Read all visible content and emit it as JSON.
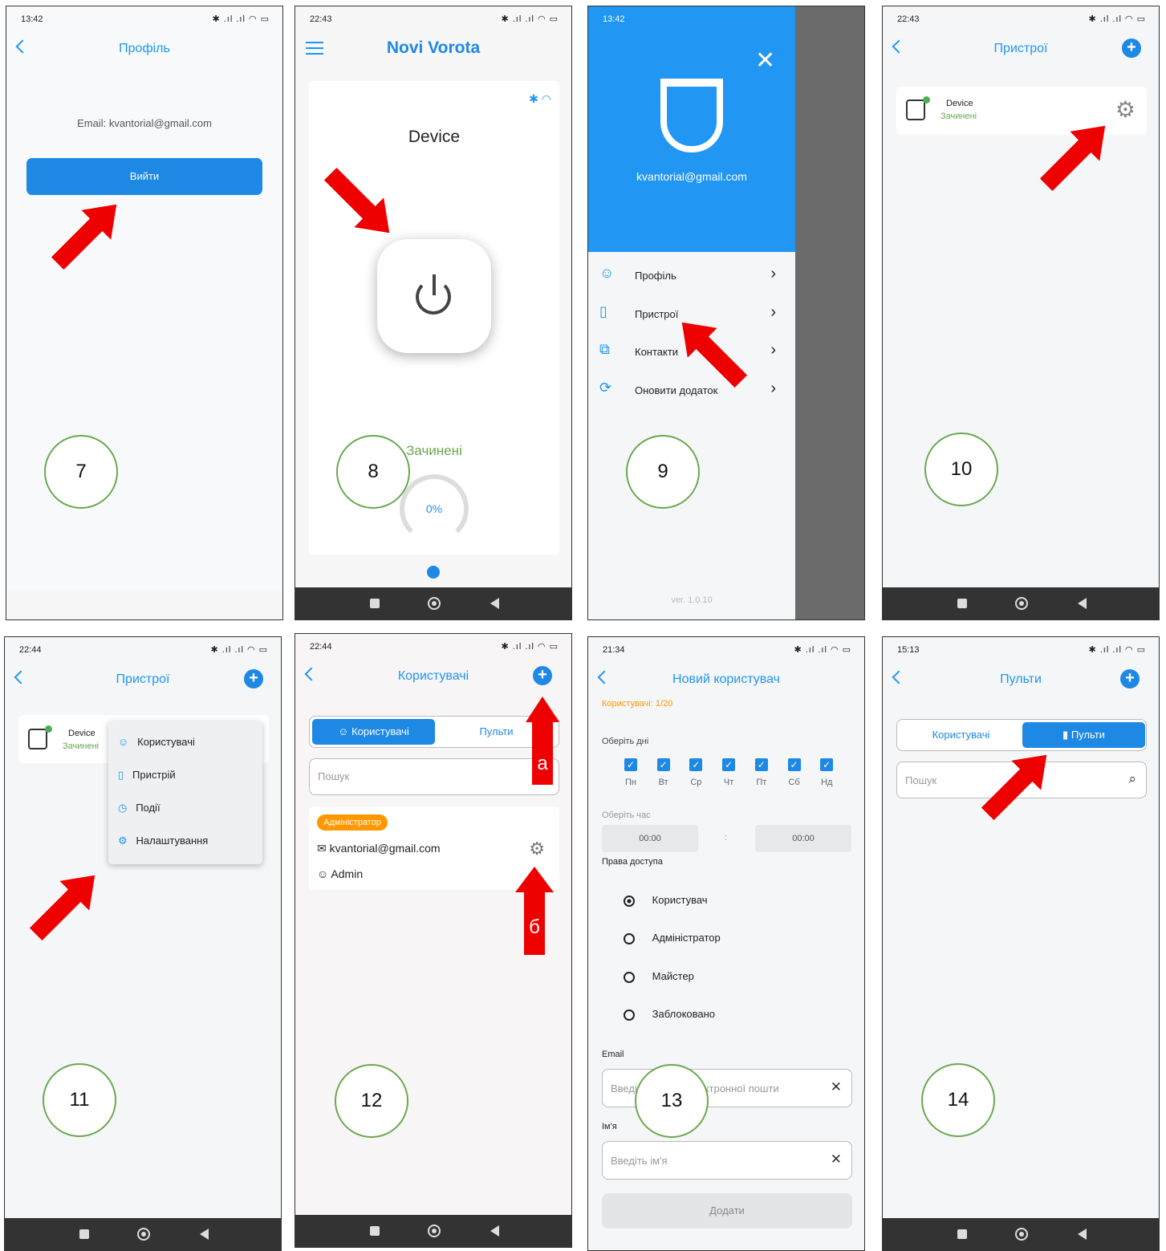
{
  "p7": {
    "time": "13:42",
    "status_icons": "✱ .ıl .ıl ◠ ▭",
    "title": "Профіль",
    "email_label": "Email:",
    "email": "kvantorial@gmail.com",
    "logout": "Вийти",
    "num": "7"
  },
  "p8": {
    "time": "22:43",
    "status_icons": "✱ .ıl .ıl ◠ ▭",
    "title": "Novi Vorota",
    "device": "Device",
    "state": "Зачинені",
    "percent": "0%",
    "num": "8"
  },
  "p9": {
    "time": "13:42",
    "status_icons": "✱ .ıl .ıl ◠ ▭",
    "email": "kvantorial@gmail.com",
    "menu": [
      "Профіль",
      "Пристрої",
      "Контакти",
      "Оновити додаток"
    ],
    "version": "ver. 1.0.10",
    "num": "9"
  },
  "p10": {
    "time": "22:43",
    "status_icons": "✱ .ıl .ıl ◠ ▭",
    "title": "Пристрої",
    "device": "Device",
    "state": "Зачинені",
    "num": "10"
  },
  "p11": {
    "time": "22:44",
    "status_icons": "✱ .ıl .ıl ◠ ▭",
    "title": "Пристрої",
    "device": "Device",
    "state": "Зачинені",
    "menu": [
      "Користувачі",
      "Пристрій",
      "Події",
      "Налаштування"
    ],
    "num": "11"
  },
  "p12": {
    "time": "22:44",
    "status_icons": "✱ .ıl .ıl ◠ ▭",
    "title": "Користувачі",
    "tab_users": "Користувачі",
    "tab_remotes": "Пульти",
    "search": "Пошук",
    "badge": "Адміністратор",
    "email": "kvantorial@gmail.com",
    "name": "Admin",
    "label_a": "а",
    "label_b": "б",
    "num": "12"
  },
  "p13": {
    "time": "21:34",
    "status_icons": "✱ .ıl .ıl ◠ ▭",
    "title": "Новий користувач",
    "counter": "Користувачі: 1/20",
    "days_label": "Оберіть дні",
    "days": [
      "Пн",
      "Вт",
      "Ср",
      "Чт",
      "Пт",
      "Сб",
      "Нд"
    ],
    "time_label": "Оберіть час",
    "time_from": "00:00",
    "time_sep": ":",
    "time_to": "00:00",
    "rights_label": "Права доступа",
    "roles": [
      "Користувач",
      "Адміністратор",
      "Майстер",
      "Заблоковано"
    ],
    "email_label": "Email",
    "email_ph": "Введіть адресу електронної пошти",
    "name_label": "Ім'я",
    "name_ph": "Введіть ім'я",
    "add": "Додати",
    "num": "13"
  },
  "p14": {
    "time": "15:13",
    "status_icons": "✱ .ıl .ıl ◠ ▭",
    "title": "Пульти",
    "tab_users": "Користувачі",
    "tab_remotes": "Пульти",
    "search": "Пошук",
    "num": "14"
  }
}
